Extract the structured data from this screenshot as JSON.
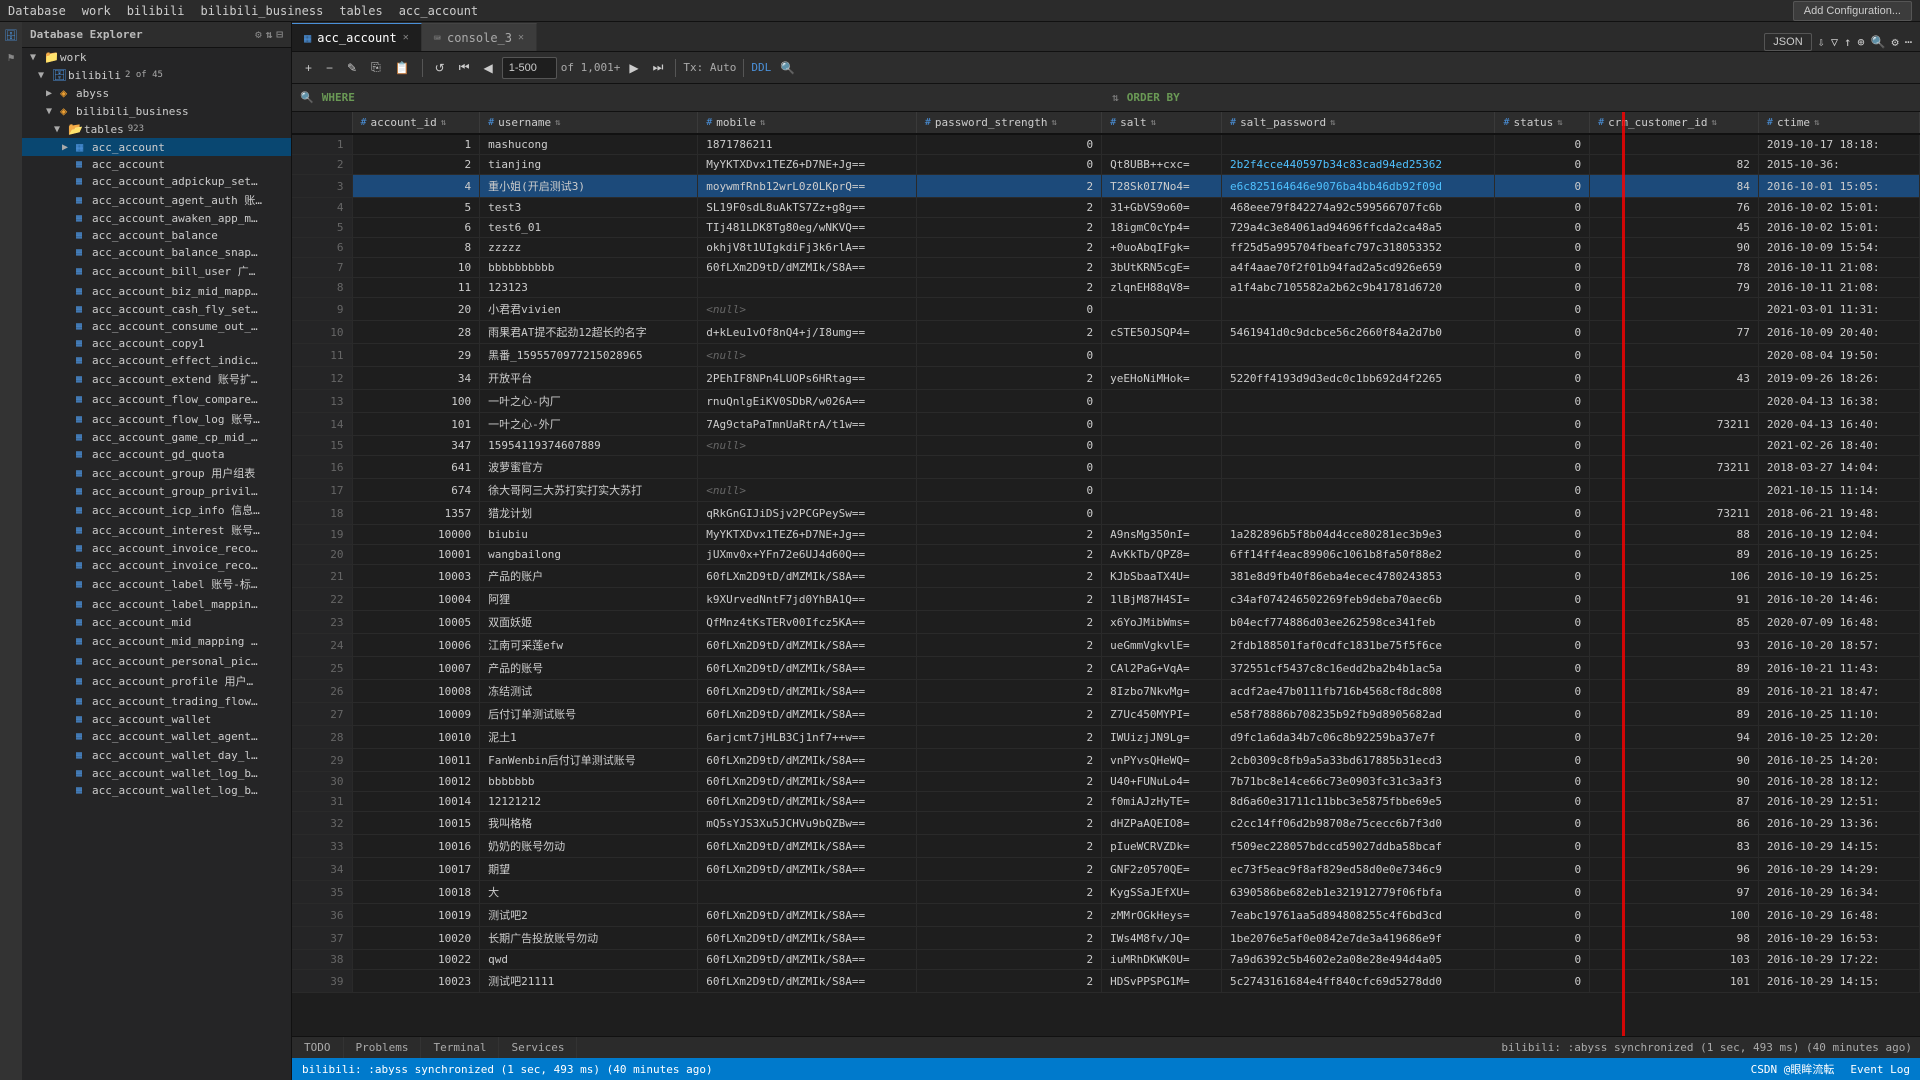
{
  "menubar": {
    "items": [
      "Database",
      "work",
      "bilibili",
      "bilibili_business",
      "tables",
      "acc_account"
    ]
  },
  "tabs": [
    {
      "label": "acc_account",
      "active": true
    },
    {
      "label": "console_3",
      "active": false
    }
  ],
  "topbar": {
    "add_config": "Add Configuration...",
    "format": "JSON"
  },
  "toolbar": {
    "range": "1-500",
    "total": "of 1,001+",
    "tx": "Tx: Auto",
    "ddl": "DDL"
  },
  "query": {
    "where_label": "WHERE",
    "orderby_label": "ORDER BY"
  },
  "columns": [
    {
      "name": "account_id",
      "icon": "#"
    },
    {
      "name": "username",
      "icon": "#"
    },
    {
      "name": "mobile",
      "icon": "#"
    },
    {
      "name": "password_strength",
      "icon": "#"
    },
    {
      "name": "salt",
      "icon": "#"
    },
    {
      "name": "salt_password",
      "icon": "#"
    },
    {
      "name": "status",
      "icon": "#"
    },
    {
      "name": "crm_customer_id",
      "icon": "#"
    },
    {
      "name": "ctime",
      "icon": "#"
    }
  ],
  "rows": [
    {
      "num": 1,
      "account_id": "1",
      "username": "mashucong",
      "mobile": "1871786211",
      "password_strength": "0",
      "salt": "",
      "salt_password": "",
      "status": "0",
      "crm": "",
      "ctime": "2019-10-17 18:18:"
    },
    {
      "num": 2,
      "account_id": "2",
      "username": "tianjing",
      "mobile": "MyYKTXDvx1TEZ6+D7NE+Jg==",
      "password_strength": "0",
      "salt": "Qt8UBB++cxc=",
      "salt_password": "2b2f4cce440597b34c83cad94ed25362",
      "status": "0",
      "crm": "82",
      "ctime": "2015-10-36:"
    },
    {
      "num": 3,
      "account_id": "4",
      "username": "重小姐(开启测试3)",
      "mobile": "moywmfRnb12wrL0z0LKprQ==",
      "password_strength": "2",
      "salt": "T28Sk0I7No4=",
      "salt_password": "e6c825164646e9076ba4bb46db92f09d",
      "status": "0",
      "crm": "84",
      "ctime": "2016-10-01 15:05:"
    },
    {
      "num": 4,
      "account_id": "5",
      "username": "test3",
      "mobile": "SL19F0sdL8uAkTS7Zz+g8g==",
      "password_strength": "2",
      "salt": "31+GbVS9o60=",
      "salt_password": "468eee79f842274a92c599566707fc6b",
      "status": "0",
      "crm": "76",
      "ctime": "2016-10-02 15:01:"
    },
    {
      "num": 5,
      "account_id": "6",
      "username": "test6_01",
      "mobile": "TIj481LDK8Tg80eg/wNKVQ==",
      "password_strength": "2",
      "salt": "18igmC0cYp4=",
      "salt_password": "729a4c3e84061ad94696ffcda2ca48a5",
      "status": "0",
      "crm": "45",
      "ctime": "2016-10-02 15:01:"
    },
    {
      "num": 6,
      "account_id": "8",
      "username": "zzzzz",
      "mobile": "okhjV8t1UIgkdiFj3k6rlA==",
      "password_strength": "2",
      "salt": "+0uoAbqIFgk=",
      "salt_password": "ff25d5a995704fbeafc797c318053352",
      "status": "0",
      "crm": "90",
      "ctime": "2016-10-09 15:54:"
    },
    {
      "num": 7,
      "account_id": "10",
      "username": "bbbbbbbbbb",
      "mobile": "60fLXm2D9tD/dMZMIk/S8A==",
      "password_strength": "2",
      "salt": "3bUtKRN5cgE=",
      "salt_password": "a4f4aae70f2f01b94fad2a5cd926e659",
      "status": "0",
      "crm": "78",
      "ctime": "2016-10-11 21:08:"
    },
    {
      "num": 8,
      "account_id": "11",
      "username": "123123",
      "mobile": "",
      "password_strength": "2",
      "salt": "zlqnEH88qV8=",
      "salt_password": "a1f4abc7105582a2b62c9b41781d6720",
      "status": "0",
      "crm": "79",
      "ctime": "2016-10-11 21:08:"
    },
    {
      "num": 9,
      "account_id": "20",
      "username": "小君君vivien",
      "mobile": "<null>",
      "password_strength": "0",
      "salt": "",
      "salt_password": "",
      "status": "0",
      "crm": "",
      "ctime": "2021-03-01 11:31:"
    },
    {
      "num": 10,
      "account_id": "28",
      "username": "雨果君AT提不起劲12超长的名字",
      "mobile": "d+kLeu1vOf8nQ4+j/I8umg==",
      "password_strength": "2",
      "salt": "cSTE50JSQP4=",
      "salt_password": "5461941d0c9dcbce56c2660f84a2d7b0",
      "status": "0",
      "crm": "77",
      "ctime": "2016-10-09 20:40:"
    },
    {
      "num": 11,
      "account_id": "29",
      "username": "黑番_159557097721502896​5",
      "mobile": "<null>",
      "password_strength": "0",
      "salt": "",
      "salt_password": "",
      "status": "0",
      "crm": "",
      "ctime": "2020-08-04 19:50:"
    },
    {
      "num": 12,
      "account_id": "34",
      "username": "开放平台",
      "mobile": "2PEhIF8NPn4LUOPs6HRtag==",
      "password_strength": "2",
      "salt": "yeEHoNiMHok=",
      "salt_password": "5220ff4193d9d3edc0c1bb692d4f2265",
      "status": "0",
      "crm": "43",
      "ctime": "2019-09-26 18:26:"
    },
    {
      "num": 13,
      "account_id": "100",
      "username": "一叶之心-内厂",
      "mobile": "rnuQnlgEiKV0SDbR/w026A==",
      "password_strength": "0",
      "salt": "",
      "salt_password": "",
      "status": "0",
      "crm": "",
      "ctime": "2020-04-13 16:38:"
    },
    {
      "num": 14,
      "account_id": "101",
      "username": "一叶之心-外厂",
      "mobile": "7Ag9ctaPaTmnUaRtrA/t1w==",
      "password_strength": "0",
      "salt": "",
      "salt_password": "",
      "status": "0",
      "crm": "73211",
      "ctime": "2020-04-13 16:40:"
    },
    {
      "num": 15,
      "account_id": "347",
      "username": "15954119374607889",
      "mobile": "<null>",
      "password_strength": "0",
      "salt": "",
      "salt_password": "",
      "status": "0",
      "crm": "",
      "ctime": "2021-02-26 18:40:"
    },
    {
      "num": 16,
      "account_id": "641",
      "username": "波萝蜜官方",
      "mobile": "",
      "password_strength": "0",
      "salt": "",
      "salt_password": "",
      "status": "0",
      "crm": "73211",
      "ctime": "2018-03-27 14:04:"
    },
    {
      "num": 17,
      "account_id": "674",
      "username": "徐大哥阿三大苏打实打实大苏打",
      "mobile": "<null>",
      "password_strength": "0",
      "salt": "",
      "salt_password": "",
      "status": "0",
      "crm": "",
      "ctime": "2021-10-15 11:14:"
    },
    {
      "num": 18,
      "account_id": "1357",
      "username": "猎龙计划",
      "mobile": "qRkGnGIJiDSjv2PCGPeySw==",
      "password_strength": "0",
      "salt": "",
      "salt_password": "",
      "status": "0",
      "crm": "73211",
      "ctime": "2018-06-21 19:48:"
    },
    {
      "num": 19,
      "account_id": "10000",
      "username": "biubiu",
      "mobile": "MyYKTXDvx1TEZ6+D7NE+Jg==",
      "password_strength": "2",
      "salt": "A9nsMg350nI=",
      "salt_password": "1a282896b5f8b04d4cce80281ec3b9e3",
      "status": "0",
      "crm": "88",
      "ctime": "2016-10-19 12:04:"
    },
    {
      "num": 20,
      "account_id": "10001",
      "username": "wangbailong",
      "mobile": "jUXmv0x+YFn72e6UJ4d60Q==",
      "password_strength": "2",
      "salt": "AvKkTb/QPZ8=",
      "salt_password": "6ff14ff4eac89906c1061b8fa50f88e2",
      "status": "0",
      "crm": "89",
      "ctime": "2016-10-19 16:25:"
    },
    {
      "num": 21,
      "account_id": "10003",
      "username": "产品的账户",
      "mobile": "60fLXm2D9tD/dMZMIk/S8A==",
      "password_strength": "2",
      "salt": "KJbSbaaTX4U=",
      "salt_password": "381e8d9fb40f86eba4ecec4780243853",
      "status": "0",
      "crm": "106",
      "ctime": "2016-10-19 16:25:"
    },
    {
      "num": 22,
      "account_id": "10004",
      "username": "阿狸",
      "mobile": "k9XUrvedNntF7jd0YhBA1Q==",
      "password_strength": "2",
      "salt": "1lBjM87H4SI=",
      "salt_password": "c34af074246502269feb9deba70aec6b",
      "status": "0",
      "crm": "91",
      "ctime": "2016-10-20 14:46:"
    },
    {
      "num": 23,
      "account_id": "10005",
      "username": "双面妖姬",
      "mobile": "QfMnz4tKsTERv00Ifcz5KA==",
      "password_strength": "2",
      "salt": "x6YoJMibWms=",
      "salt_password": "b04ecf774886d03ee262598ce341feb",
      "status": "0",
      "crm": "85",
      "ctime": "2020-07-09 16:48:"
    },
    {
      "num": 24,
      "account_id": "10006",
      "username": "江南可采莲efw",
      "mobile": "60fLXm2D9tD/dMZMIk/S8A==",
      "password_strength": "2",
      "salt": "ueGmmVgkvlE=",
      "salt_password": "2fdb188501faf0cdfc1831be75f5f6ce",
      "status": "0",
      "crm": "93",
      "ctime": "2016-10-20 18:57:"
    },
    {
      "num": 25,
      "account_id": "10007",
      "username": "产品的账号",
      "mobile": "60fLXm2D9tD/dMZMIk/S8A==",
      "password_strength": "2",
      "salt": "CAl2PaG+VqA=",
      "salt_password": "372551cf5437c8c16edd2ba2b4b1ac5a",
      "status": "0",
      "crm": "89",
      "ctime": "2016-10-21 11:43:"
    },
    {
      "num": 26,
      "account_id": "10008",
      "username": "冻结测试",
      "mobile": "60fLXm2D9tD/dMZMIk/S8A==",
      "password_strength": "2",
      "salt": "8Izbo7NkvMg=",
      "salt_password": "acdf2ae47b0111fb716b4568cf8dc808",
      "status": "0",
      "crm": "89",
      "ctime": "2016-10-21 18:47:"
    },
    {
      "num": 27,
      "account_id": "10009",
      "username": "后付订单测试账号",
      "mobile": "60fLXm2D9tD/dMZMIk/S8A==",
      "password_strength": "2",
      "salt": "Z7Uc450MYPI=",
      "salt_password": "e58f78886b708235b92fb9d8905682ad",
      "status": "0",
      "crm": "89",
      "ctime": "2016-10-25 11:10:"
    },
    {
      "num": 28,
      "account_id": "10010",
      "username": "泥土1",
      "mobile": "6arjcmt7jHLB3Cj1nf7++w==",
      "password_strength": "2",
      "salt": "IWUizjJN9Lg=",
      "salt_password": "d9fc1a6da34b7c06c8b92259ba37e7f",
      "status": "0",
      "crm": "94",
      "ctime": "2016-10-25 12:20:"
    },
    {
      "num": 29,
      "account_id": "10011",
      "username": "FanWenbin后付订单测试账号",
      "mobile": "60fLXm2D9tD/dMZMIk/S8A==",
      "password_strength": "2",
      "salt": "vnPYvsQHeWQ=",
      "salt_password": "2cb0309c8fb9a5a33bd617885b31ecd3",
      "status": "0",
      "crm": "90",
      "ctime": "2016-10-25 14:20:"
    },
    {
      "num": 30,
      "account_id": "10012",
      "username": "bbbbbbb",
      "mobile": "60fLXm2D9tD/dMZMIk/S8A==",
      "password_strength": "2",
      "salt": "U40+FUNuLo4=",
      "salt_password": "7b71bc8e14ce66c73e0903fc31c3a3f3",
      "status": "0",
      "crm": "90",
      "ctime": "2016-10-28 18:12:"
    },
    {
      "num": 31,
      "account_id": "10014",
      "username": "12121212",
      "mobile": "60fLXm2D9tD/dMZMIk/S8A==",
      "password_strength": "2",
      "salt": "f0miAJzHyTE=",
      "salt_password": "8d6a60e31711c11bbc3e5875fbbe69e5",
      "status": "0",
      "crm": "87",
      "ctime": "2016-10-29 12:51:"
    },
    {
      "num": 32,
      "account_id": "10015",
      "username": "我叫格格",
      "mobile": "mQ5sYJS3Xu5JCHVu9bQZBw==",
      "password_strength": "2",
      "salt": "dHZPaAQEIO8=",
      "salt_password": "c2cc14ff06d2b98708e75cecc6b7f3d0",
      "status": "0",
      "crm": "86",
      "ctime": "2016-10-29 13:36:"
    },
    {
      "num": 33,
      "account_id": "10016",
      "username": "奶奶的账号勿动",
      "mobile": "60fLXm2D9tD/dMZMIk/S8A==",
      "password_strength": "2",
      "salt": "pIueWCRVZDk=",
      "salt_password": "f509ec228057bdccd59027ddba58bcaf",
      "status": "0",
      "crm": "83",
      "ctime": "2016-10-29 14:15:"
    },
    {
      "num": 34,
      "account_id": "10017",
      "username": "期望",
      "mobile": "60fLXm2D9tD/dMZMIk/S8A==",
      "password_strength": "2",
      "salt": "GNF2z0570QE=",
      "salt_password": "ec73f5eac9f8af829ed58d0e0e7346c9",
      "status": "0",
      "crm": "96",
      "ctime": "2016-10-29 14:29:"
    },
    {
      "num": 35,
      "account_id": "10018",
      "username": "大",
      "mobile": "",
      "password_strength": "2",
      "salt": "KygSSaJEfXU=",
      "salt_password": "6390586be682eb1e321912779f06fbfa",
      "status": "0",
      "crm": "97",
      "ctime": "2016-10-29 16:34:"
    },
    {
      "num": 36,
      "account_id": "10019",
      "username": "测试吧2",
      "mobile": "60fLXm2D9tD/dMZMIk/S8A==",
      "password_strength": "2",
      "salt": "zMMrOGkHeys=",
      "salt_password": "7eabc19761aa5d894808255c4f6bd3cd",
      "status": "0",
      "crm": "100",
      "ctime": "2016-10-29 16:48:"
    },
    {
      "num": 37,
      "account_id": "10020",
      "username": "长期广告投放账号勿动",
      "mobile": "60fLXm2D9tD/dMZMIk/S8A==",
      "password_strength": "2",
      "salt": "IWs4M8fv/JQ=",
      "salt_password": "1be2076e5af0e0842e7de3a419686e9f",
      "status": "0",
      "crm": "98",
      "ctime": "2016-10-29 16:53:"
    },
    {
      "num": 38,
      "account_id": "10022",
      "username": "qwd",
      "mobile": "60fLXm2D9tD/dMZMIk/S8A==",
      "password_strength": "2",
      "salt": "iuMRhDKWK0U=",
      "salt_password": "7a9d6392c5b4602e2a08e28e494d4a05",
      "status": "0",
      "crm": "103",
      "ctime": "2016-10-29 17:22:"
    },
    {
      "num": 39,
      "account_id": "10023",
      "username": "测试吧21111",
      "mobile": "60fLXm2D9tD/dMZMIk/S8A==",
      "password_strength": "2",
      "salt": "HDSvPPSPG1M=",
      "salt_password": "5c2743161684e4ff840cfc69d5278dd0",
      "status": "0",
      "crm": "101",
      "ctime": "2016-10-29 14:15:"
    }
  ],
  "sidebar": {
    "title": "Database Explorer",
    "tree": {
      "work": {
        "label": "work",
        "children": {
          "bilibili": {
            "label": "bilibili",
            "badge": "2 of 45",
            "children": {
              "abyss": {
                "label": "abyss"
              },
              "bilibili_business": {
                "label": "bilibili_business",
                "children": {
                  "tables_label": "tables",
                  "tables_count": "923",
                  "acc_account": "acc_account"
                }
              }
            }
          }
        }
      }
    }
  },
  "table_items": [
    "acc_account",
    "acc_account_adpickup_settle_info",
    "acc_account_agent_auth 账户代理",
    "acc_account_awaken_app_mapping",
    "acc_account_balance",
    "acc_account_balance_snapshot",
    "acc_account_bill_user 广告主与内用",
    "acc_account_biz_mid_mapping 广",
    "acc_account_cash_fly_settle_info",
    "acc_account_consume_out_budget",
    "acc_account_copy1",
    "acc_account_effect_indicator_confi",
    "acc_account_extend 账号扩展表",
    "acc_account_flow_compare 代理服",
    "acc_account_flow_log 账号流水表",
    "acc_account_game_cp_mid_mappi",
    "acc_account_gd_quota",
    "acc_account_group 用户组表",
    "acc_account_group_privilege_map",
    "acc_account_icp_info 信息备案信",
    "acc_account_interest 账号及兴趣标签",
    "acc_account_invoice_record",
    "acc_account_invoice_record_sale_r",
    "acc_account_label 账号-标签表",
    "acc_account_label_mapping 账号-",
    "acc_account_mid",
    "acc_account_mid_mapping 账号关联",
    "acc_account_personal_pics 个人品",
    "acc_account_profile 用户账号属性",
    "acc_account_trading_flow_day 广",
    "acc_account_wallet",
    "acc_account_wallet_agent_day_log",
    "acc_account_wallet_day_log 用户",
    "acc_account_wallet_log_bak_2017",
    "acc_account_wallet_log_bak_2018"
  ],
  "statusbar": {
    "text": "bilibili: :abyss synchronized (1 sec, 493 ms) (40 minutes ago)",
    "right": "CSDN @眼眸流転",
    "event_log": "Event Log"
  },
  "bottom_tabs": [
    "TODO",
    "Problems",
    "Terminal",
    "Services"
  ]
}
